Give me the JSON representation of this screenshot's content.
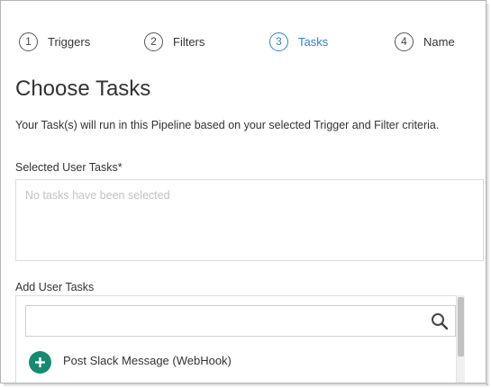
{
  "stepper": {
    "steps": [
      {
        "number": "1",
        "label": "Triggers",
        "active": false
      },
      {
        "number": "2",
        "label": "Filters",
        "active": false
      },
      {
        "number": "3",
        "label": "Tasks",
        "active": true
      },
      {
        "number": "4",
        "label": "Name",
        "active": false
      }
    ],
    "active_color": "#2e7fd0"
  },
  "page": {
    "title": "Choose Tasks",
    "description": "Your Task(s) will run in this Pipeline based on your selected Trigger and Filter criteria."
  },
  "selected_tasks": {
    "label": "Selected User Tasks*",
    "empty_text": "No tasks have been selected"
  },
  "add_tasks": {
    "label": "Add User Tasks",
    "search": {
      "value": "",
      "placeholder": ""
    },
    "items": [
      {
        "name": "Post Slack Message (WebHook)",
        "icon": "plus-icon"
      }
    ],
    "add_button_color": "#178a72"
  }
}
